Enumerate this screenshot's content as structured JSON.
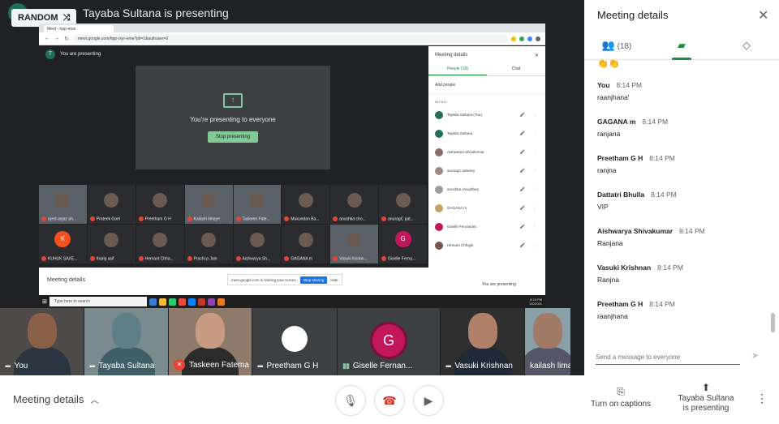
{
  "presenter_banner": "Tayaba Sultana is presenting",
  "random_chip": "RANDOM",
  "shared_screen": {
    "tab_label": "Meet - hpp-eme",
    "url": "meet.google.com/hpp-rxyr-eme?pli=1&authuser=2",
    "you_are_presenting": "You are presenting",
    "presenting_to_everyone": "You're presenting to everyone",
    "stop_presenting": "Stop presenting",
    "participants": [
      {
        "name": "syed anjaz ah...",
        "kind": "video"
      },
      {
        "name": "Prateek Goel",
        "kind": "photo"
      },
      {
        "name": "Preetham G H",
        "kind": "photo"
      },
      {
        "name": "Kailash limaye",
        "kind": "video"
      },
      {
        "name": "Taskeen Fate...",
        "kind": "video"
      },
      {
        "name": "Mukundan Ba...",
        "kind": "photo"
      },
      {
        "name": "anushka cho...",
        "kind": "photo"
      },
      {
        "name": "anuragC pat...",
        "kind": "photo"
      },
      {
        "name": "KUHUK SAXE...",
        "kind": "letter",
        "letter": "K",
        "color": "#f4511e"
      },
      {
        "name": "tharig asif",
        "kind": "photo"
      },
      {
        "name": "Hemant Chha...",
        "kind": "photo"
      },
      {
        "name": "Prachi p Jain",
        "kind": "photo"
      },
      {
        "name": "Aishwarya Sh...",
        "kind": "photo"
      },
      {
        "name": "GAGANA m",
        "kind": "photo"
      },
      {
        "name": "Vasuki Krishn...",
        "kind": "video"
      },
      {
        "name": "Giselle Ferna...",
        "kind": "letter",
        "letter": "G",
        "color": "#c2185b"
      }
    ],
    "panel": {
      "title": "Meeting details",
      "tab_people": "People (18)",
      "tab_chat": "Chat",
      "add_people": "Add people",
      "in_call": "IN CALL",
      "people": [
        {
          "name": "Tayaba Sultana (You)",
          "color": "#1e6f5c"
        },
        {
          "name": "Tayaba Sultana",
          "color": "#1e6f5c"
        },
        {
          "name": "Aishwarya Shivakumar",
          "color": "#8d6e63"
        },
        {
          "name": "anuragC patwary",
          "color": "#a1887f"
        },
        {
          "name": "anushka choudhary",
          "color": "#9e9e9e"
        },
        {
          "name": "GAGANA m",
          "color": "#c8a165"
        },
        {
          "name": "Giselle Fernandez",
          "color": "#c2185b"
        },
        {
          "name": "Hemant Chhajer",
          "color": "#795548"
        }
      ]
    },
    "bottom": {
      "meeting_details": "Meeting details",
      "share_notice": "meet.google.com is sharing your screen.",
      "stop_sharing": "Stop sharing",
      "hide": "Hide",
      "you_are_presenting": "You are presenting"
    },
    "taskbar": {
      "search": "Type here to search",
      "time": "8:15 PM",
      "date": "3/1/2021"
    }
  },
  "filmstrip": [
    {
      "name": "You",
      "mic": "dots",
      "bg": "#4e4a48",
      "skin": "#8a6048",
      "shirt": "#2a3540"
    },
    {
      "name": "Tayaba Sultana",
      "mic": "dots",
      "bg": "#7a8a8f",
      "skin": "#5f7f87",
      "shirt": "#3f5e66"
    },
    {
      "name": "Taskeen Fatema",
      "mic": "muted",
      "bg": "#8e7a6a",
      "skin": "#c99a82",
      "shirt": "#2b2b2b"
    },
    {
      "name": "Preetham G H",
      "mic": "dots",
      "bg": "#3c4043",
      "kind": "speaker"
    },
    {
      "name": "Giselle Fernan...",
      "mic": "speaking",
      "bg": "#3c4043",
      "kind": "letter",
      "letter": "G"
    },
    {
      "name": "Vasuki Krishnan",
      "mic": "dots",
      "bg": "#2f2f2f",
      "skin": "#b0806a",
      "shirt": "#1f2a36"
    },
    {
      "name": "kailash limaye",
      "mic": "none",
      "bg": "#8aa0a8",
      "skin": "#a07a66",
      "shirt": "#556"
    }
  ],
  "bottom_bar": {
    "meeting_details": "Meeting details",
    "turn_on_captions": "Turn on captions",
    "presenter_line1": "Tayaba Sultana",
    "presenter_line2": "is presenting"
  },
  "side_panel": {
    "title": "Meeting details",
    "people_count": "(18)",
    "chat_placeholder": "Send a message to everyone",
    "emoji": "👏👏",
    "messages": [
      {
        "sender": "You",
        "time": "8:14 PM",
        "text": "raanjhana'"
      },
      {
        "sender": "GAGANA m",
        "time": "8:14 PM",
        "text": "ranjana"
      },
      {
        "sender": "Preetham G H",
        "time": "8:14 PM",
        "text": "ranjna"
      },
      {
        "sender": "Dattatri Bhulla",
        "time": "8:14 PM",
        "text": "VIP"
      },
      {
        "sender": "Aishwarya Shivakumar",
        "time": "8:14 PM",
        "text": "Ranjana"
      },
      {
        "sender": "Vasuki Krishnan",
        "time": "8:14 PM",
        "text": "Ranjna"
      },
      {
        "sender": "Preetham G H",
        "time": "8:14 PM",
        "text": "raanjhana"
      }
    ]
  }
}
